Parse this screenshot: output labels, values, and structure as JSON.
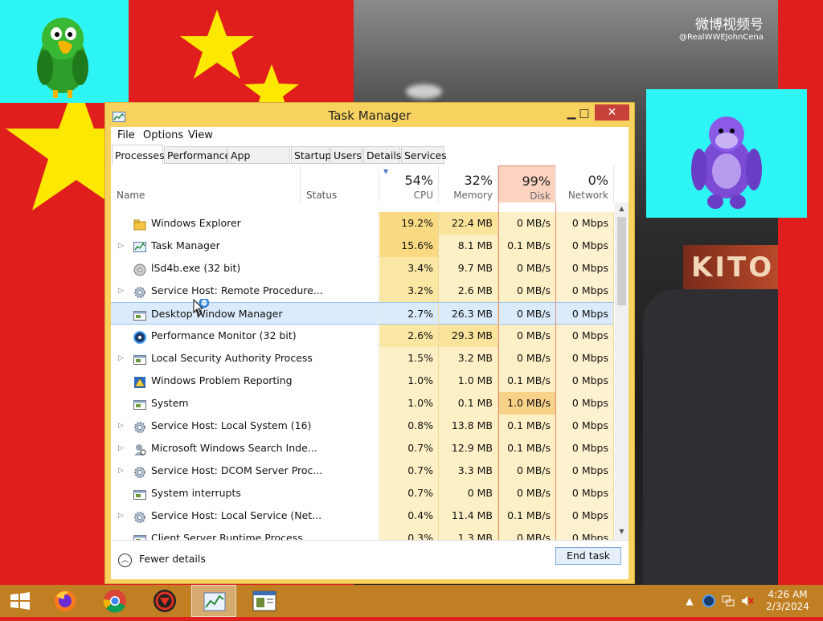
{
  "overlay": {
    "watermark_brand": "微博视频号",
    "watermark_handle": "@RealWWEJohnCena",
    "sign_text": "KITO"
  },
  "window": {
    "title": "Task Manager",
    "menu": [
      "File",
      "Options",
      "View"
    ],
    "tabs": [
      "Processes",
      "Performance",
      "App history",
      "Startup",
      "Users",
      "Details",
      "Services"
    ],
    "active_tab": "Processes"
  },
  "columns": {
    "name": "Name",
    "status": "Status",
    "cpu": {
      "pct": "54%",
      "label": "CPU"
    },
    "memory": {
      "pct": "32%",
      "label": "Memory"
    },
    "disk": {
      "pct": "99%",
      "label": "Disk"
    },
    "network": {
      "pct": "0%",
      "label": "Network"
    }
  },
  "processes": [
    {
      "name": "Windows Explorer",
      "cpu": "19.2%",
      "memory": "22.4 MB",
      "disk": "0 MB/s",
      "network": "0 Mbps",
      "expander": false,
      "icon": "explorer-icon"
    },
    {
      "name": "Task Manager",
      "cpu": "15.6%",
      "memory": "8.1 MB",
      "disk": "0.1 MB/s",
      "network": "0 Mbps",
      "expander": true,
      "icon": "taskmgr-icon"
    },
    {
      "name": "lSd4b.exe (32 bit)",
      "cpu": "3.4%",
      "memory": "9.7 MB",
      "disk": "0 MB/s",
      "network": "0 Mbps",
      "expander": false,
      "icon": "disc-icon"
    },
    {
      "name": "Service Host: Remote Procedure...",
      "cpu": "3.2%",
      "memory": "2.6 MB",
      "disk": "0 MB/s",
      "network": "0 Mbps",
      "expander": true,
      "icon": "gear-icon"
    },
    {
      "name": "Desktop Window Manager",
      "cpu": "2.7%",
      "memory": "26.3 MB",
      "disk": "0 MB/s",
      "network": "0 Mbps",
      "expander": false,
      "icon": "window-icon",
      "selected": true
    },
    {
      "name": "Performance Monitor (32 bit)",
      "cpu": "2.6%",
      "memory": "29.3 MB",
      "disk": "0 MB/s",
      "network": "0 Mbps",
      "expander": false,
      "icon": "perfmon-icon"
    },
    {
      "name": "Local Security Authority Process",
      "cpu": "1.5%",
      "memory": "3.2 MB",
      "disk": "0 MB/s",
      "network": "0 Mbps",
      "expander": true,
      "icon": "window-icon"
    },
    {
      "name": "Windows Problem Reporting",
      "cpu": "1.0%",
      "memory": "1.0 MB",
      "disk": "0.1 MB/s",
      "network": "0 Mbps",
      "expander": false,
      "icon": "report-icon"
    },
    {
      "name": "System",
      "cpu": "1.0%",
      "memory": "0.1 MB",
      "disk": "1.0 MB/s",
      "network": "0 Mbps",
      "expander": false,
      "icon": "window-icon"
    },
    {
      "name": "Service Host: Local System (16)",
      "cpu": "0.8%",
      "memory": "13.8 MB",
      "disk": "0.1 MB/s",
      "network": "0 Mbps",
      "expander": true,
      "icon": "gear-icon"
    },
    {
      "name": "Microsoft Windows Search Inde...",
      "cpu": "0.7%",
      "memory": "12.9 MB",
      "disk": "0.1 MB/s",
      "network": "0 Mbps",
      "expander": true,
      "icon": "search-user-icon"
    },
    {
      "name": "Service Host: DCOM Server Proc...",
      "cpu": "0.7%",
      "memory": "3.3 MB",
      "disk": "0 MB/s",
      "network": "0 Mbps",
      "expander": true,
      "icon": "gear-icon"
    },
    {
      "name": "System interrupts",
      "cpu": "0.7%",
      "memory": "0 MB",
      "disk": "0 MB/s",
      "network": "0 Mbps",
      "expander": false,
      "icon": "window-icon"
    },
    {
      "name": "Service Host: Local Service (Net...",
      "cpu": "0.4%",
      "memory": "11.4 MB",
      "disk": "0.1 MB/s",
      "network": "0 Mbps",
      "expander": true,
      "icon": "gear-icon"
    },
    {
      "name": "Client Server Runtime Process",
      "cpu": "0.3%",
      "memory": "1.3 MB",
      "disk": "0 MB/s",
      "network": "0 Mbps",
      "expander": false,
      "icon": "window-icon"
    }
  ],
  "footer": {
    "fewer_details": "Fewer details",
    "end_task": "End task"
  },
  "taskbar": {
    "time": "4:26 AM",
    "date": "2/3/2024",
    "pinned": [
      "firefox-icon",
      "chrome-icon",
      "red-app-icon",
      "taskmgr-icon",
      "perfmon-icon"
    ]
  },
  "colors": {
    "desktop_red": "#e01e1e",
    "cyan_box": "#2ef5f5",
    "window_frame": "#f8d25f",
    "taskbar": "#c17f23",
    "heat_high": "#f9da82",
    "heat_low": "#fdf2cf",
    "disk_header": "#fcd2c1"
  }
}
